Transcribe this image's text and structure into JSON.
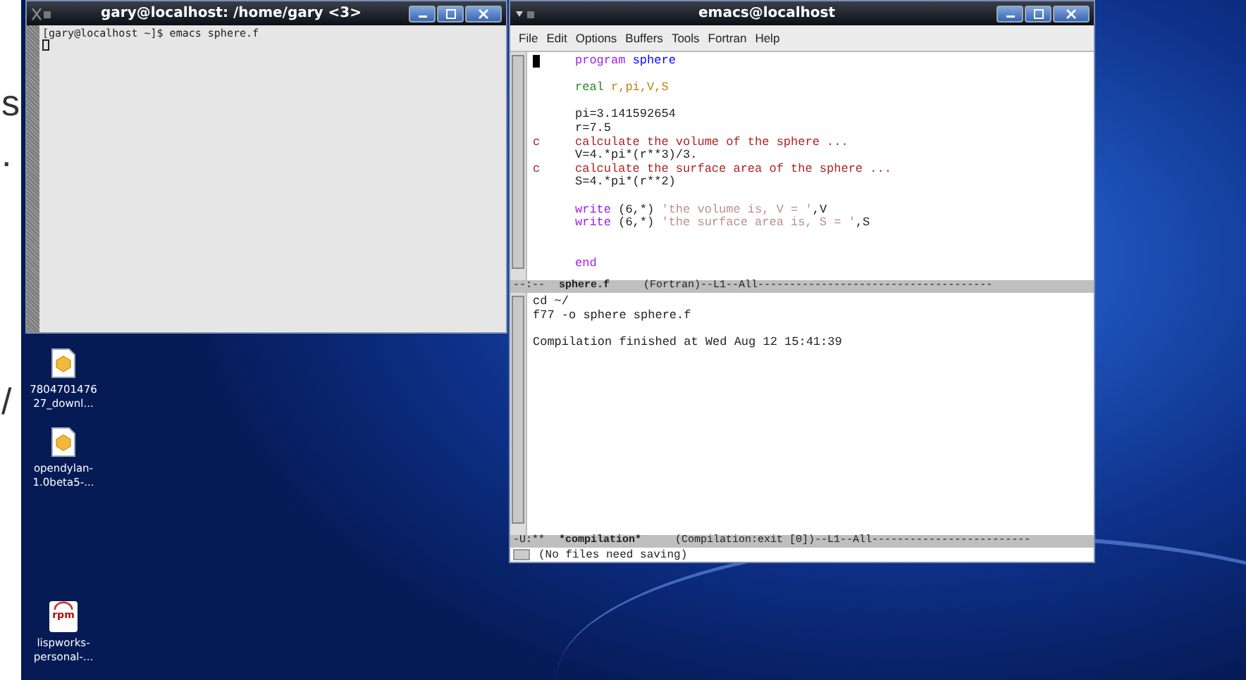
{
  "edge_fragments": [
    "s",
    ".",
    "/"
  ],
  "terminal": {
    "title": "gary@localhost: /home/gary <3>",
    "lines": [
      "[gary@localhost ~]$ emacs sphere.f"
    ]
  },
  "emacs": {
    "title": "emacs@localhost",
    "menu": [
      "File",
      "Edit",
      "Options",
      "Buffers",
      "Tools",
      "Fortran",
      "Help"
    ],
    "code_blocks": [
      [
        {
          "segments": [
            {
              "kind": "keyword",
              "text": "program"
            },
            {
              "kind": "name",
              "text": "sphere"
            }
          ]
        }
      ],
      [
        {
          "segments": [
            {
              "kind": "type",
              "text": "real"
            },
            {
              "kind": "variable",
              "text": "r,pi,V,S"
            }
          ]
        }
      ],
      [
        {
          "segments": [
            {
              "kind": "plain",
              "text": "pi=3.141592654"
            }
          ]
        },
        {
          "segments": [
            {
              "kind": "plain",
              "text": "r=7.5"
            }
          ]
        },
        {
          "marker": "c",
          "segments": [
            {
              "kind": "comment",
              "text": "calculate the volume of the sphere ..."
            }
          ]
        },
        {
          "segments": [
            {
              "kind": "plain",
              "text": "V=4.*pi*(r**3)/3."
            }
          ]
        },
        {
          "marker": "c",
          "segments": [
            {
              "kind": "comment",
              "text": "calculate the surface area of the sphere ..."
            }
          ]
        },
        {
          "segments": [
            {
              "kind": "plain",
              "text": "S=4.*pi*(r**2)"
            }
          ]
        }
      ],
      [
        {
          "segments": [
            {
              "kind": "keyword",
              "text": "write"
            },
            {
              "kind": "plain",
              "text": "(6,*)"
            },
            {
              "kind": "string",
              "text": "'the volume is, V = '"
            },
            {
              "kind": "plain",
              "text": ",V"
            }
          ]
        },
        {
          "segments": [
            {
              "kind": "keyword",
              "text": "write"
            },
            {
              "kind": "plain",
              "text": "(6,*)"
            },
            {
              "kind": "string",
              "text": "'the surface area is, S = '"
            },
            {
              "kind": "plain",
              "text": ",S"
            }
          ]
        }
      ],
      [
        {
          "segments": [
            {
              "kind": "keyword",
              "text": "end"
            }
          ]
        }
      ]
    ],
    "mode_line_1": {
      "status": "--:--",
      "buffer": "sphere.f",
      "info": "(Fortran)--L1--All-------------------------------------"
    },
    "compilation_lines": [
      [
        "cd ~/",
        "f77 -o sphere sphere.f"
      ],
      [
        "Compilation finished at Wed Aug 12 15:41:39"
      ]
    ],
    "mode_line_2": {
      "status": "-U:**",
      "buffer": "*compilation*",
      "info": "(Compilation:exit [0])--L1--All-------------------------"
    },
    "minibuffer": "(No files need saving)"
  },
  "desktop_icons": [
    {
      "kind": "package",
      "label": [
        "7804701476",
        "27_downl..."
      ]
    },
    {
      "kind": "package",
      "label": [
        "opendylan-",
        "1.0beta5-..."
      ]
    },
    {
      "kind": "rpm",
      "badge": "rpm",
      "label": [
        "lispworks-",
        "personal-..."
      ]
    }
  ]
}
